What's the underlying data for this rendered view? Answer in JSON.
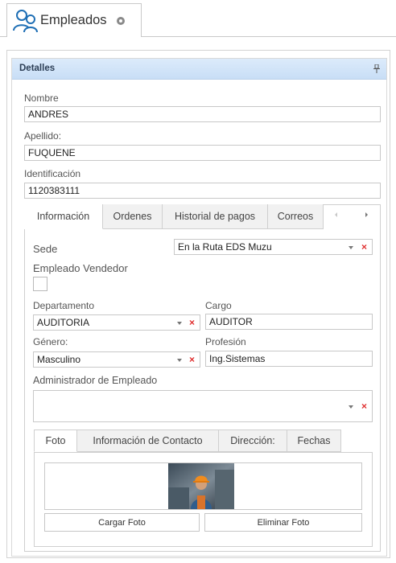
{
  "document_tab": {
    "title": "Empleados",
    "icon": "employees-icon",
    "close_icon": "close-circle-icon"
  },
  "panel": {
    "title": "Detalles",
    "pin_icon": "pin-icon"
  },
  "fields": {
    "nombre": {
      "label": "Nombre",
      "value": "ANDRES"
    },
    "apellido": {
      "label": "Apellido:",
      "value": "FUQUENE"
    },
    "identificacion": {
      "label": "Identificación",
      "value": "1120383111"
    }
  },
  "tabs": {
    "items": [
      "Información",
      "Ordenes",
      "Historial de pagos",
      "Correos"
    ],
    "active": "Información",
    "nav_left": "‹",
    "nav_right": "›"
  },
  "info": {
    "sede": {
      "label": "Sede",
      "value": "En la Ruta EDS Muzu"
    },
    "vendedor": {
      "label": "Empleado Vendedor",
      "checked": false
    },
    "departamento": {
      "label": "Departamento",
      "value": "AUDITORIA"
    },
    "cargo": {
      "label": "Cargo",
      "value": "AUDITOR"
    },
    "genero": {
      "label": "Género:",
      "value": "Masculino"
    },
    "profesion": {
      "label": "Profesión",
      "value": "Ing.Sistemas"
    },
    "administrador": {
      "label": "Administrador de Empleado",
      "value": ""
    },
    "clear_glyph": "×"
  },
  "inner_tabs": {
    "items": [
      "Foto",
      "Información de Contacto",
      "Dirección:",
      "Fechas"
    ],
    "active": "Foto"
  },
  "photo": {
    "upload_label": "Cargar Foto",
    "delete_label": "Eliminar Foto"
  },
  "colors": {
    "header_bg": "#d4e6f9",
    "clear_red": "#e03030",
    "accent": "#1f6fb5"
  }
}
